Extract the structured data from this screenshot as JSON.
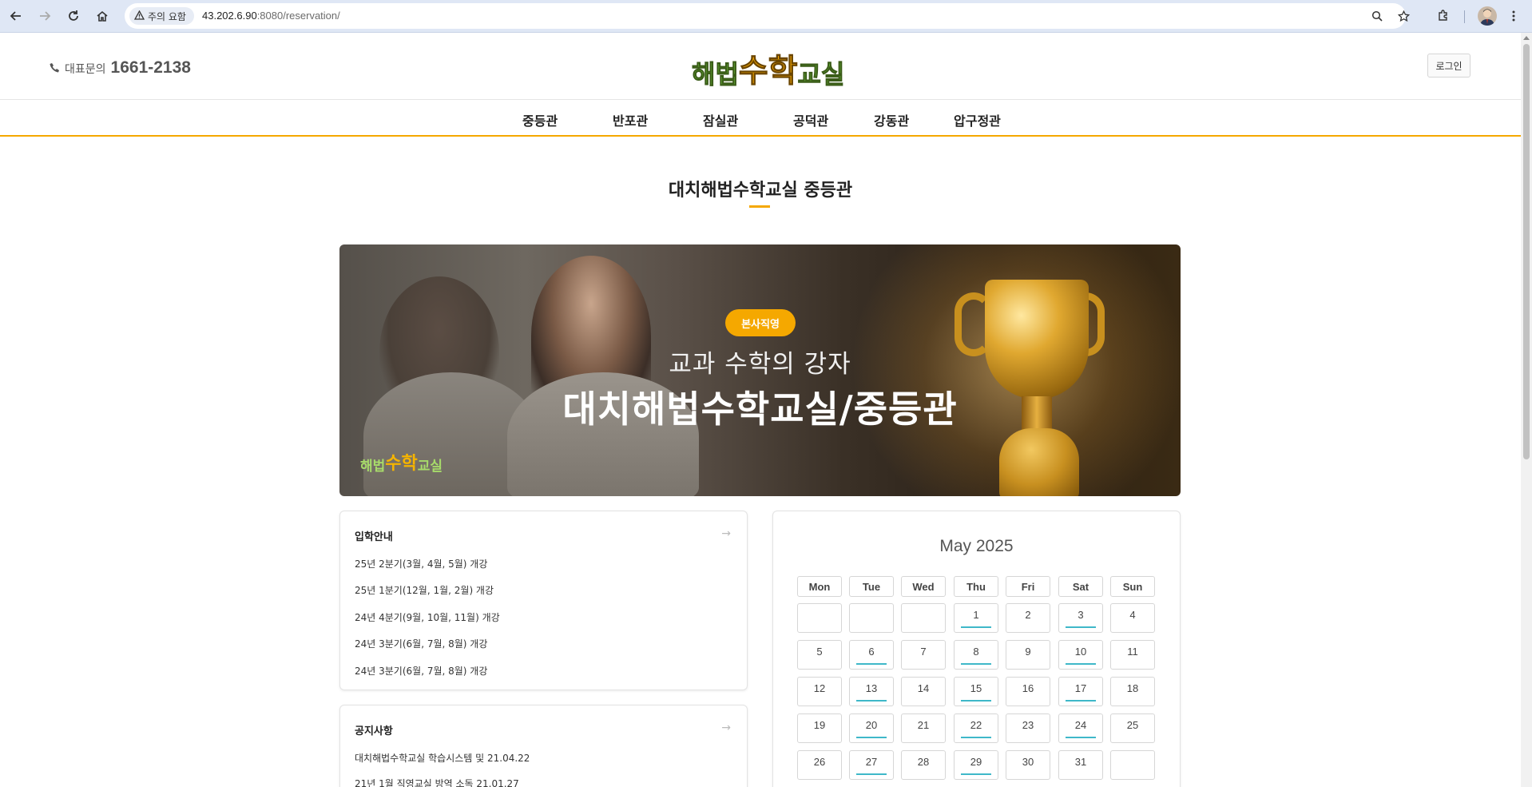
{
  "browser": {
    "security_chip": "주의 요함",
    "url_host": "43.202.6.90",
    "url_rest": ":8080/reservation/"
  },
  "header": {
    "phone_label": "대표문의",
    "phone_number": "1661-2138",
    "logo": {
      "part1": "해법",
      "part2": "수학",
      "part3": "교실"
    },
    "login_label": "로그인"
  },
  "branches": [
    "중등관",
    "반포관",
    "잠실관",
    "공덕관",
    "강동관",
    "압구정관"
  ],
  "page_title": "대치해법수학교실 중등관",
  "banner": {
    "badge": "본사직영",
    "subtitle": "교과 수학의 강자",
    "title": "대치해법수학교실/중등관",
    "logo": {
      "part1": "해법",
      "part2": "수학",
      "part3": "교실"
    }
  },
  "admission": {
    "title": "입학안내",
    "arrow": "→",
    "items": [
      "25년 2분기(3월, 4월, 5월) 개강",
      "25년 1분기(12월, 1월, 2월) 개강",
      "24년 4분기(9월, 10월, 11월) 개강",
      "24년 3분기(6월, 7월, 8월) 개강",
      "24년 3분기(6월, 7월, 8월) 개강"
    ]
  },
  "notice": {
    "title": "공지사항",
    "arrow": "→",
    "items": [
      "대치해법수학교실 학습시스템 및 21.04.22",
      "21년 1월 직영교실 방역 소독 21.01.27"
    ]
  },
  "calendar": {
    "title": "May 2025",
    "weekdays": [
      "Mon",
      "Tue",
      "Wed",
      "Thu",
      "Fri",
      "Sat",
      "Sun"
    ],
    "weeks": [
      [
        {
          "d": ""
        },
        {
          "d": ""
        },
        {
          "d": ""
        },
        {
          "d": "1",
          "m": true
        },
        {
          "d": "2"
        },
        {
          "d": "3",
          "m": true
        },
        {
          "d": "4"
        }
      ],
      [
        {
          "d": "5"
        },
        {
          "d": "6",
          "m": true
        },
        {
          "d": "7"
        },
        {
          "d": "8",
          "m": true
        },
        {
          "d": "9"
        },
        {
          "d": "10",
          "m": true
        },
        {
          "d": "11"
        }
      ],
      [
        {
          "d": "12"
        },
        {
          "d": "13",
          "m": true
        },
        {
          "d": "14"
        },
        {
          "d": "15",
          "m": true
        },
        {
          "d": "16"
        },
        {
          "d": "17",
          "m": true
        },
        {
          "d": "18"
        }
      ],
      [
        {
          "d": "19"
        },
        {
          "d": "20",
          "m": true
        },
        {
          "d": "21"
        },
        {
          "d": "22",
          "m": true
        },
        {
          "d": "23"
        },
        {
          "d": "24",
          "m": true
        },
        {
          "d": "25"
        }
      ],
      [
        {
          "d": "26"
        },
        {
          "d": "27",
          "m": true
        },
        {
          "d": "28"
        },
        {
          "d": "29",
          "m": true
        },
        {
          "d": "30"
        },
        {
          "d": "31"
        },
        {
          "d": ""
        }
      ]
    ]
  },
  "colors": {
    "accent": "#f5a800",
    "available_mark": "#3fb8c9",
    "logo_green": "#6bbd3a"
  }
}
